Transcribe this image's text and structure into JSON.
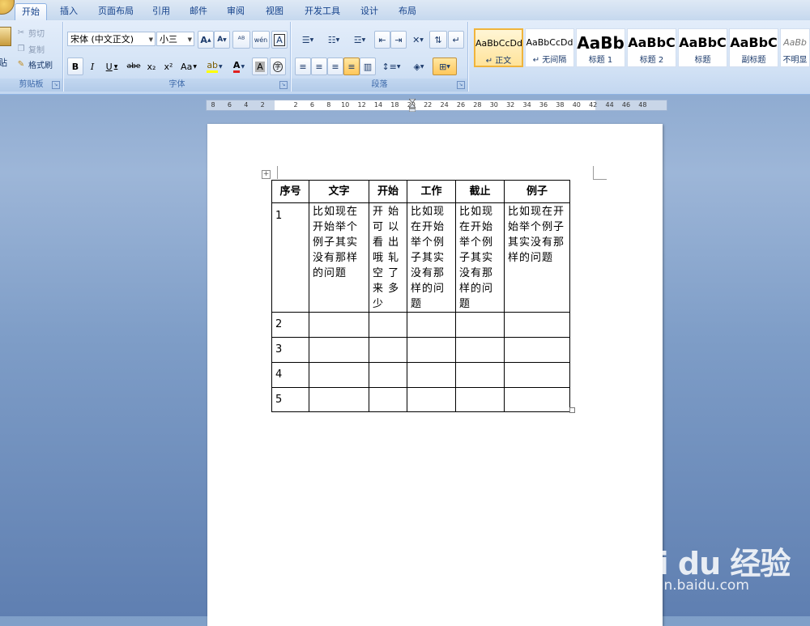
{
  "ribbon": {
    "tabs": [
      {
        "label": "开始",
        "active": true
      },
      {
        "label": "插入"
      },
      {
        "label": "页面布局"
      },
      {
        "label": "引用"
      },
      {
        "label": "邮件"
      },
      {
        "label": "审阅"
      },
      {
        "label": "视图"
      },
      {
        "label": "开发工具"
      },
      {
        "label": "设计"
      },
      {
        "label": "布局"
      }
    ],
    "clipboard": {
      "paste": "贴",
      "cut": "剪切",
      "copy": "复制",
      "format_painter": "格式刷",
      "label": "剪贴板"
    },
    "font": {
      "font_name": "宋体 (中文正文)",
      "font_size": "小三",
      "bold": "B",
      "italic": "I",
      "underline": "U",
      "strike": "abe",
      "subscript": "x₂",
      "superscript": "x²",
      "change_case": "Aa",
      "font_color": "A",
      "char_shading": "A",
      "enclose": "字",
      "grow": "A",
      "shrink": "A",
      "phonetic": "wén",
      "char_border": "A",
      "label": "字体"
    },
    "paragraph": {
      "label": "段落"
    },
    "styles": [
      {
        "preview": "AaBbCcDd",
        "name": "正文",
        "selected": true
      },
      {
        "preview": "AaBbCcDd",
        "name": "无间隔"
      },
      {
        "preview": "AaBb",
        "name": "标题 1"
      },
      {
        "preview": "AaBbC",
        "name": "标题 2"
      },
      {
        "preview": "AaBbC",
        "name": "标题"
      },
      {
        "preview": "AaBbC",
        "name": "副标题"
      },
      {
        "preview": "AaBb",
        "name": "不明显"
      }
    ]
  },
  "ruler": {
    "numbers": [
      "8",
      "6",
      "4",
      "2",
      "",
      "2",
      "6",
      "8",
      "10",
      "12",
      "14",
      "18",
      "20",
      "22",
      "24",
      "26",
      "28",
      "30",
      "32",
      "34",
      "36",
      "38",
      "40",
      "42",
      "44",
      "46",
      "48"
    ]
  },
  "table": {
    "headers": [
      "序号",
      "文字",
      "开始",
      "工作",
      "截止",
      "例子"
    ],
    "rows": [
      [
        "1",
        "比如现在开始举个例子其实没有那样的问题",
        "开 始可 以看 出哦 轧空 了来 多少",
        "比如现在开始举个例子其实没有那样的问题",
        "比如现在开始举个例子其实没有那样的问题",
        "比如现在开始举个例子其实没有那样的问题"
      ],
      [
        "2",
        "",
        "",
        "",
        "",
        ""
      ],
      [
        "3",
        "",
        "",
        "",
        "",
        ""
      ],
      [
        "4",
        "",
        "",
        "",
        "",
        ""
      ],
      [
        "5",
        "",
        "",
        "",
        "",
        ""
      ]
    ]
  },
  "watermark": {
    "logo": "Bai du 经验",
    "url": "jingyan.baidu.com"
  }
}
